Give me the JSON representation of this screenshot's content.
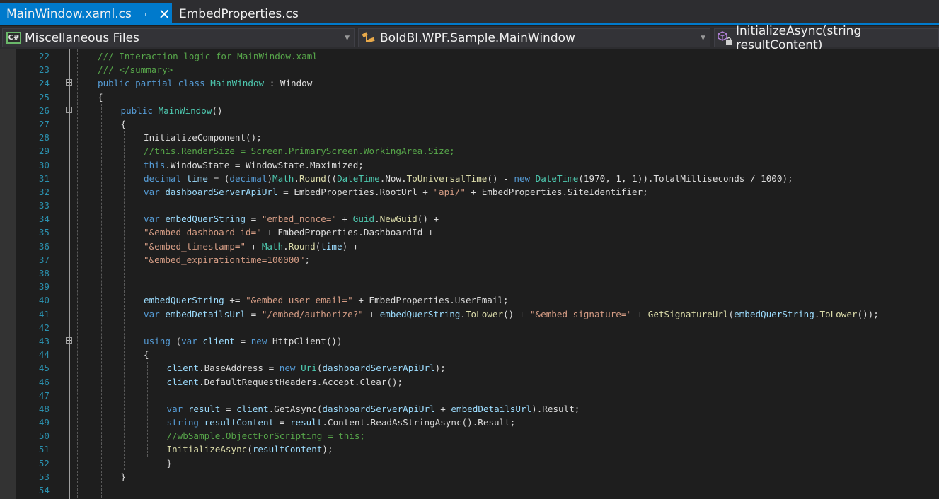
{
  "tabs": [
    {
      "label": "MainWindow.xaml.cs",
      "active": true,
      "pinned": true
    },
    {
      "label": "EmbedProperties.cs",
      "active": false
    }
  ],
  "navbar": {
    "project": {
      "label": "Miscellaneous Files",
      "icon": "csharp-project-icon"
    },
    "type": {
      "label": "BoldBI.WPF.Sample.MainWindow",
      "icon": "class-icon"
    },
    "member": {
      "label": "InitializeAsync(string resultContent)",
      "icon": "private-method-icon"
    }
  },
  "colors": {
    "accent": "#007acc",
    "background": "#1e1e1e",
    "line_number": "#2b91af",
    "keyword": "#569cd6",
    "type": "#4ec9b0",
    "comment": "#57a64a",
    "string": "#d69d85",
    "method": "#dcdcaa",
    "variable": "#9cdcfe"
  },
  "code_lines": [
    {
      "n": 22,
      "fold": false,
      "tokens": [
        [
          "cm",
          "/// Interaction logic for MainWindow.xaml"
        ]
      ],
      "indent": 0
    },
    {
      "n": 23,
      "fold": false,
      "tokens": [
        [
          "cm",
          "/// </summary>"
        ]
      ],
      "indent": 0
    },
    {
      "n": 24,
      "fold": true,
      "tokens": [
        [
          "kw",
          "public"
        ],
        [
          "pl",
          " "
        ],
        [
          "kw",
          "partial"
        ],
        [
          "pl",
          " "
        ],
        [
          "kw",
          "class"
        ],
        [
          "pl",
          " "
        ],
        [
          "ty",
          "MainWindow"
        ],
        [
          "pl",
          " : Window"
        ]
      ],
      "indent": 0
    },
    {
      "n": 25,
      "fold": false,
      "tokens": [
        [
          "pl",
          "{"
        ]
      ],
      "indent": 0
    },
    {
      "n": 26,
      "fold": true,
      "tokens": [
        [
          "kw",
          "public"
        ],
        [
          "pl",
          " "
        ],
        [
          "ty",
          "MainWindow"
        ],
        [
          "pl",
          "()"
        ]
      ],
      "indent": 1
    },
    {
      "n": 27,
      "fold": false,
      "tokens": [
        [
          "pl",
          "{"
        ]
      ],
      "indent": 1
    },
    {
      "n": 28,
      "fold": false,
      "tokens": [
        [
          "pl",
          "InitializeComponent();"
        ]
      ],
      "indent": 2
    },
    {
      "n": 29,
      "fold": false,
      "tokens": [
        [
          "cm",
          "//this.RenderSize = Screen.PrimaryScreen.WorkingArea.Size;"
        ]
      ],
      "indent": 2
    },
    {
      "n": 30,
      "fold": false,
      "tokens": [
        [
          "kw",
          "this"
        ],
        [
          "pl",
          ".WindowState = WindowState.Maximized;"
        ]
      ],
      "indent": 2
    },
    {
      "n": 31,
      "fold": false,
      "tokens": [
        [
          "kw",
          "decimal"
        ],
        [
          "pl",
          " "
        ],
        [
          "vr",
          "time"
        ],
        [
          "pl",
          " = ("
        ],
        [
          "kw",
          "decimal"
        ],
        [
          "pl",
          ")"
        ],
        [
          "ty",
          "Math"
        ],
        [
          "pl",
          "."
        ],
        [
          "mt",
          "Round"
        ],
        [
          "pl",
          "(("
        ],
        [
          "ty",
          "DateTime"
        ],
        [
          "pl",
          ".Now."
        ],
        [
          "mt",
          "ToUniversalTime"
        ],
        [
          "pl",
          "() - "
        ],
        [
          "kw",
          "new"
        ],
        [
          "pl",
          " "
        ],
        [
          "ty",
          "DateTime"
        ],
        [
          "pl",
          "(1970, 1, 1)).TotalMilliseconds / 1000);"
        ]
      ],
      "indent": 2
    },
    {
      "n": 32,
      "fold": false,
      "tokens": [
        [
          "kw",
          "var"
        ],
        [
          "pl",
          " "
        ],
        [
          "vr",
          "dashboardServerApiUrl"
        ],
        [
          "pl",
          " = EmbedProperties.RootUrl + "
        ],
        [
          "st",
          "\"api/\""
        ],
        [
          "pl",
          " + EmbedProperties.SiteIdentifier;"
        ]
      ],
      "indent": 2
    },
    {
      "n": 33,
      "fold": false,
      "tokens": [],
      "indent": 2
    },
    {
      "n": 34,
      "fold": false,
      "tokens": [
        [
          "kw",
          "var"
        ],
        [
          "pl",
          " "
        ],
        [
          "vr",
          "embedQuerString"
        ],
        [
          "pl",
          " = "
        ],
        [
          "st",
          "\"embed_nonce=\""
        ],
        [
          "pl",
          " + "
        ],
        [
          "ty",
          "Guid"
        ],
        [
          "pl",
          "."
        ],
        [
          "mt",
          "NewGuid"
        ],
        [
          "pl",
          "() +"
        ]
      ],
      "indent": 2
    },
    {
      "n": 35,
      "fold": false,
      "tokens": [
        [
          "st",
          "\"&embed_dashboard_id=\""
        ],
        [
          "pl",
          " + EmbedProperties.DashboardId +"
        ]
      ],
      "indent": 2
    },
    {
      "n": 36,
      "fold": false,
      "tokens": [
        [
          "st",
          "\"&embed_timestamp=\""
        ],
        [
          "pl",
          " + "
        ],
        [
          "ty",
          "Math"
        ],
        [
          "pl",
          "."
        ],
        [
          "mt",
          "Round"
        ],
        [
          "pl",
          "("
        ],
        [
          "vr",
          "time"
        ],
        [
          "pl",
          ") +"
        ]
      ],
      "indent": 2
    },
    {
      "n": 37,
      "fold": false,
      "tokens": [
        [
          "st",
          "\"&embed_expirationtime=100000\""
        ],
        [
          "pl",
          ";"
        ]
      ],
      "indent": 2
    },
    {
      "n": 38,
      "fold": false,
      "tokens": [],
      "indent": 2
    },
    {
      "n": 39,
      "fold": false,
      "tokens": [],
      "indent": 2
    },
    {
      "n": 40,
      "fold": false,
      "tokens": [
        [
          "vr",
          "embedQuerString"
        ],
        [
          "pl",
          " += "
        ],
        [
          "st",
          "\"&embed_user_email=\""
        ],
        [
          "pl",
          " + EmbedProperties.UserEmail;"
        ]
      ],
      "indent": 2
    },
    {
      "n": 41,
      "fold": false,
      "tokens": [
        [
          "kw",
          "var"
        ],
        [
          "pl",
          " "
        ],
        [
          "vr",
          "embedDetailsUrl"
        ],
        [
          "pl",
          " = "
        ],
        [
          "st",
          "\"/embed/authorize?\""
        ],
        [
          "pl",
          " + "
        ],
        [
          "vr",
          "embedQuerString"
        ],
        [
          "pl",
          "."
        ],
        [
          "mt",
          "ToLower"
        ],
        [
          "pl",
          "() + "
        ],
        [
          "st",
          "\"&embed_signature=\""
        ],
        [
          "pl",
          " + "
        ],
        [
          "mt",
          "GetSignatureUrl"
        ],
        [
          "pl",
          "("
        ],
        [
          "vr",
          "embedQuerString"
        ],
        [
          "pl",
          "."
        ],
        [
          "mt",
          "ToLower"
        ],
        [
          "pl",
          "());"
        ]
      ],
      "indent": 2
    },
    {
      "n": 42,
      "fold": false,
      "tokens": [],
      "indent": 2
    },
    {
      "n": 43,
      "fold": true,
      "tokens": [
        [
          "kw",
          "using"
        ],
        [
          "pl",
          " ("
        ],
        [
          "kw",
          "var"
        ],
        [
          "pl",
          " "
        ],
        [
          "vr",
          "client"
        ],
        [
          "pl",
          " = "
        ],
        [
          "kw",
          "new"
        ],
        [
          "pl",
          " HttpClient())"
        ]
      ],
      "indent": 2
    },
    {
      "n": 44,
      "fold": false,
      "tokens": [
        [
          "pl",
          "{"
        ]
      ],
      "indent": 2
    },
    {
      "n": 45,
      "fold": false,
      "tokens": [
        [
          "vr",
          "client"
        ],
        [
          "pl",
          ".BaseAddress = "
        ],
        [
          "kw",
          "new"
        ],
        [
          "pl",
          " "
        ],
        [
          "ty",
          "Uri"
        ],
        [
          "pl",
          "("
        ],
        [
          "vr",
          "dashboardServerApiUrl"
        ],
        [
          "pl",
          ");"
        ]
      ],
      "indent": 3
    },
    {
      "n": 46,
      "fold": false,
      "tokens": [
        [
          "vr",
          "client"
        ],
        [
          "pl",
          ".DefaultRequestHeaders.Accept.Clear();"
        ]
      ],
      "indent": 3
    },
    {
      "n": 47,
      "fold": false,
      "tokens": [],
      "indent": 3
    },
    {
      "n": 48,
      "fold": false,
      "tokens": [
        [
          "kw",
          "var"
        ],
        [
          "pl",
          " "
        ],
        [
          "vr",
          "result"
        ],
        [
          "pl",
          " = "
        ],
        [
          "vr",
          "client"
        ],
        [
          "pl",
          ".GetAsync("
        ],
        [
          "vr",
          "dashboardServerApiUrl"
        ],
        [
          "pl",
          " + "
        ],
        [
          "vr",
          "embedDetailsUrl"
        ],
        [
          "pl",
          ").Result;"
        ]
      ],
      "indent": 3
    },
    {
      "n": 49,
      "fold": false,
      "tokens": [
        [
          "kw",
          "string"
        ],
        [
          "pl",
          " "
        ],
        [
          "vr",
          "resultContent"
        ],
        [
          "pl",
          " = "
        ],
        [
          "vr",
          "result"
        ],
        [
          "pl",
          ".Content.ReadAsStringAsync().Result;"
        ]
      ],
      "indent": 3
    },
    {
      "n": 50,
      "fold": false,
      "tokens": [
        [
          "cm",
          "//wbSample.ObjectForScripting = this;"
        ]
      ],
      "indent": 3
    },
    {
      "n": 51,
      "fold": false,
      "tokens": [
        [
          "mt",
          "InitializeAsync"
        ],
        [
          "pl",
          "("
        ],
        [
          "vr",
          "resultContent"
        ],
        [
          "pl",
          ");"
        ]
      ],
      "indent": 3
    },
    {
      "n": 52,
      "fold": false,
      "tokens": [
        [
          "pl",
          "}"
        ]
      ],
      "indent": 3
    },
    {
      "n": 53,
      "fold": false,
      "tokens": [
        [
          "pl",
          "}"
        ]
      ],
      "indent": 1
    },
    {
      "n": 54,
      "fold": false,
      "tokens": [],
      "indent": 1
    }
  ]
}
